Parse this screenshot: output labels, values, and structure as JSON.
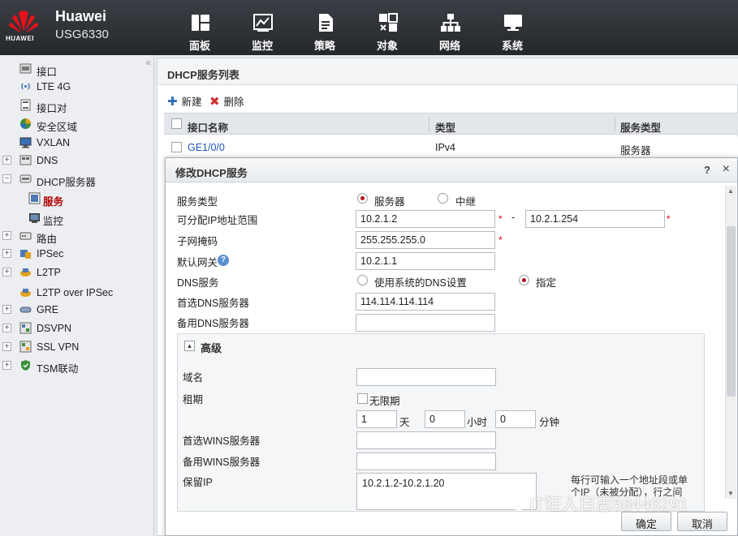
{
  "header": {
    "brand_name": "Huawei",
    "brand_sub": "HUAWEI",
    "model": "USG6330",
    "nav": [
      {
        "label": "面板",
        "icon": "dashboard-icon"
      },
      {
        "label": "监控",
        "icon": "monitor-chart-icon"
      },
      {
        "label": "策略",
        "icon": "policy-document-icon"
      },
      {
        "label": "对象",
        "icon": "object-icon"
      },
      {
        "label": "网络",
        "icon": "network-topology-icon"
      },
      {
        "label": "系统",
        "icon": "system-monitor-icon"
      }
    ]
  },
  "sidebar": {
    "collapse_glyph": "«",
    "items": [
      {
        "label": "接口",
        "icon": "interface-icon"
      },
      {
        "label": "LTE 4G",
        "icon": "wireless-icon"
      },
      {
        "label": "接口对",
        "icon": "interface-pair-icon"
      },
      {
        "label": "安全区域",
        "icon": "security-zone-icon"
      },
      {
        "label": "VXLAN",
        "icon": "vxlan-icon"
      },
      {
        "label": "DNS",
        "icon": "dns-icon"
      },
      {
        "label": "DHCP服务器",
        "icon": "dhcp-server-icon"
      },
      {
        "label": "服务",
        "icon": "service-icon"
      },
      {
        "label": "监控",
        "icon": "monitor-icon"
      },
      {
        "label": "路由",
        "icon": "route-icon"
      },
      {
        "label": "IPSec",
        "icon": "ipsec-icon"
      },
      {
        "label": "L2TP",
        "icon": "l2tp-icon"
      },
      {
        "label": "L2TP over IPSec",
        "icon": "l2tp-ipsec-icon"
      },
      {
        "label": "GRE",
        "icon": "gre-icon"
      },
      {
        "label": "DSVPN",
        "icon": "dsvpn-icon"
      },
      {
        "label": "SSL VPN",
        "icon": "ssl-vpn-icon"
      },
      {
        "label": "TSM联动",
        "icon": "tsm-shield-icon"
      }
    ]
  },
  "panel": {
    "title": "DHCP服务列表",
    "toolbar": {
      "new_label": "新建",
      "delete_label": "删除"
    },
    "columns": [
      "接口名称",
      "类型",
      "服务类型"
    ],
    "rows": [
      {
        "interface": "GE1/0/0",
        "type": "IPv4",
        "service_type": "服务器"
      }
    ]
  },
  "dialog": {
    "title": "修改DHCP服务",
    "help": "?",
    "close": "×",
    "fields": {
      "service_type_label": "服务类型",
      "service_type_options": [
        "服务器",
        "中继"
      ],
      "range_label": "可分配IP地址范围",
      "range_start": "10.2.1.2",
      "range_dash": "-",
      "range_end": "10.2.1.254",
      "mask_label": "子网掩码",
      "mask": "255.255.255.0",
      "gateway_label": "默认网关",
      "gateway": "10.2.1.1",
      "dns_label": "DNS服务",
      "dns_options": [
        "使用系统的DNS设置",
        "指定"
      ],
      "dns1_label": "首选DNS服务器",
      "dns1": "114.114.114.114",
      "dns2_label": "备用DNS服务器",
      "dns2": "",
      "required_mark": "*"
    },
    "advanced": {
      "title": "高级",
      "toggle": "▲",
      "domain_label": "域名",
      "domain": "",
      "lease_label": "租期",
      "unlimited_label": "无限期",
      "lease_days": "1",
      "days_unit": "天",
      "lease_hours": "0",
      "hours_unit": "小时",
      "lease_minutes": "0",
      "minutes_unit": "分钟",
      "wins1_label": "首选WINS服务器",
      "wins1": "",
      "wins2_label": "备用WINS服务器",
      "wins2": "",
      "reserved_label": "保留IP",
      "reserved": "10.2.1.2-10.2.1.20",
      "reserved_hint": "每行可输入一个地址段或单个IP（未被分配），行之间"
    },
    "buttons": {
      "ok": "确定",
      "cancel": "取消"
    }
  },
  "watermark": "IT狂人日志58446291",
  "colors": {
    "accent": "#b5121b",
    "header": "#2c2f33",
    "link": "#1a56b8",
    "help": "#5b8fcf"
  }
}
